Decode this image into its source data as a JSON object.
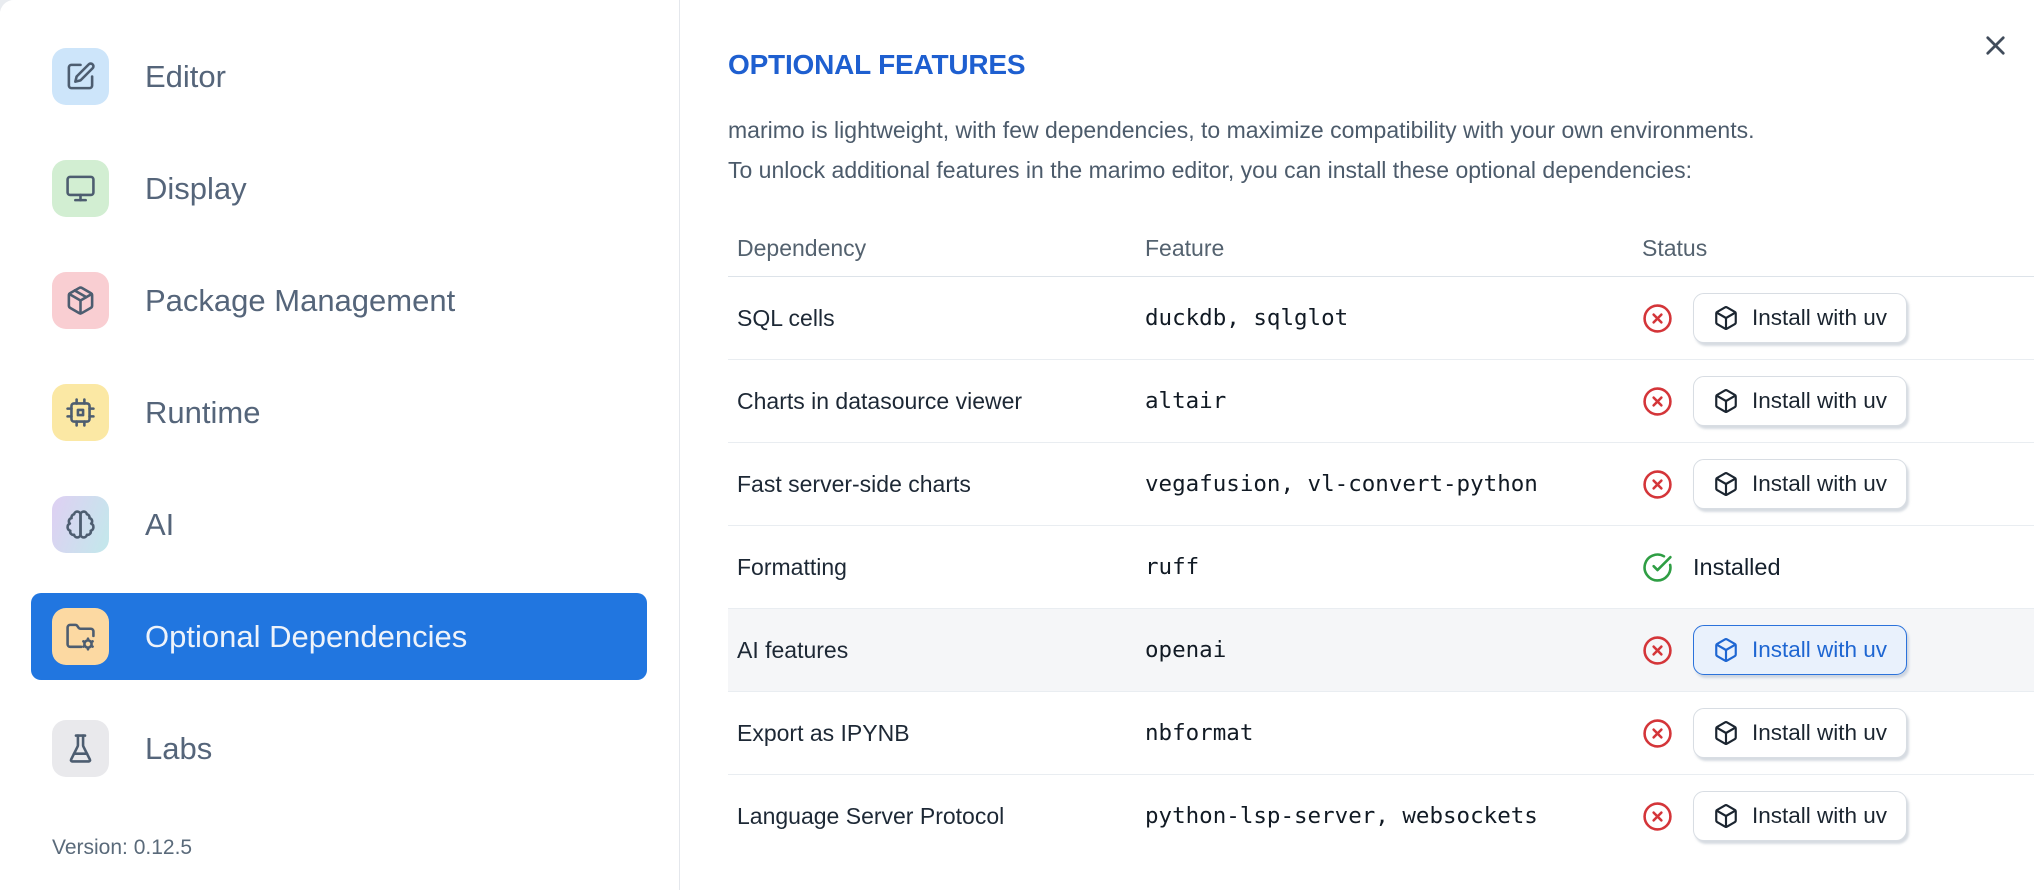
{
  "sidebar": {
    "items": [
      {
        "label": "Editor",
        "icon": "square-pen-icon"
      },
      {
        "label": "Display",
        "icon": "monitor-icon"
      },
      {
        "label": "Package Management",
        "icon": "package-icon"
      },
      {
        "label": "Runtime",
        "icon": "cpu-icon"
      },
      {
        "label": "AI",
        "icon": "brain-icon"
      },
      {
        "label": "Optional Dependencies",
        "icon": "folder-cog-icon",
        "selected": true
      },
      {
        "label": "Labs",
        "icon": "flask-icon"
      }
    ],
    "version": "Version: 0.12.5"
  },
  "main": {
    "title": "OPTIONAL FEATURES",
    "description_lines": [
      "marimo is lightweight, with few dependencies, to maximize compatibility with your own environments.",
      "To unlock additional features in the marimo editor, you can install these optional dependencies:"
    ],
    "table": {
      "headers": [
        "Dependency",
        "Feature",
        "Status"
      ],
      "install_button_label": "Install with uv",
      "installed_label": "Installed",
      "rows": [
        {
          "dependency": "SQL cells",
          "feature": "duckdb, sqlglot",
          "installed": false
        },
        {
          "dependency": "Charts in datasource viewer",
          "feature": "altair",
          "installed": false
        },
        {
          "dependency": "Fast server-side charts",
          "feature": "vegafusion, vl-convert-python",
          "installed": false
        },
        {
          "dependency": "Formatting",
          "feature": "ruff",
          "installed": true
        },
        {
          "dependency": "AI features",
          "feature": "openai",
          "installed": false,
          "highlighted": true
        },
        {
          "dependency": "Export as IPYNB",
          "feature": "nbformat",
          "installed": false
        },
        {
          "dependency": "Language Server Protocol",
          "feature": "python-lsp-server, websockets",
          "installed": false
        }
      ]
    }
  },
  "colors": {
    "selected_item_bg": "#2176e0",
    "title_blue": "#1e5fd0",
    "active_button_blue": "#1e66d2",
    "not_installed_red": "#d43539",
    "installed_green": "#2f9e44"
  }
}
